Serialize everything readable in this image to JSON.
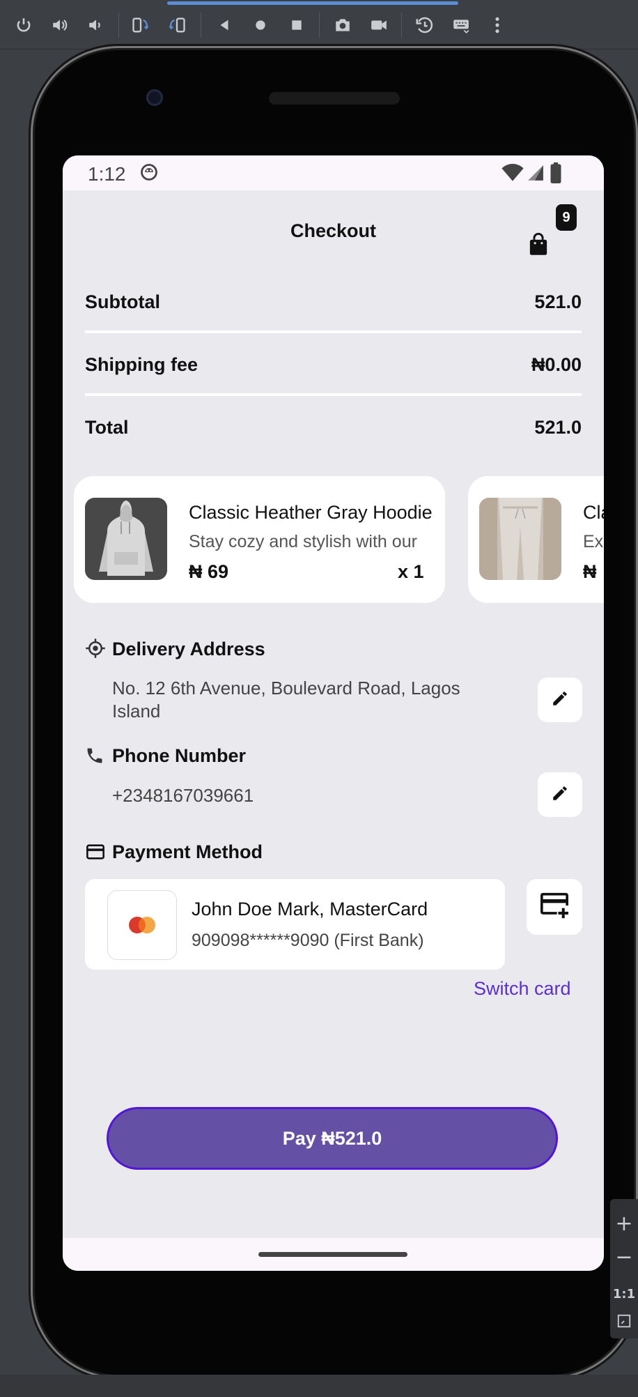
{
  "status_bar": {
    "time": "1:12"
  },
  "header": {
    "title": "Checkout",
    "cart_count": "9"
  },
  "summary": {
    "subtotal_label": "Subtotal",
    "subtotal_value": "521.0",
    "shipping_label": "Shipping fee",
    "shipping_value": "₦0.00",
    "total_label": "Total",
    "total_value": "521.0"
  },
  "products": [
    {
      "name": "Classic Heather Gray Hoodie",
      "description": "Stay cozy and stylish with our",
      "price": "₦ 69",
      "qty": "x 1"
    },
    {
      "name": "Classic",
      "description": "Ex",
      "price": "₦"
    }
  ],
  "delivery": {
    "title": "Delivery Address",
    "address": "No. 12 6th Avenue, Boulevard Road, Lagos Island"
  },
  "phone": {
    "title": "Phone Number",
    "number": "+2348167039661"
  },
  "payment": {
    "title": "Payment Method",
    "card_name": "John Doe Mark, MasterCard",
    "card_number": "909098******9090 (First Bank)",
    "switch_label": "Switch card"
  },
  "pay_button": {
    "label": "Pay ₦521.0"
  },
  "emulator": {
    "zoom_label": "1:1"
  },
  "colors": {
    "accent": "#5b2fd1",
    "pay_button": "#6451a6",
    "screen_bg": "#eae9ee"
  }
}
